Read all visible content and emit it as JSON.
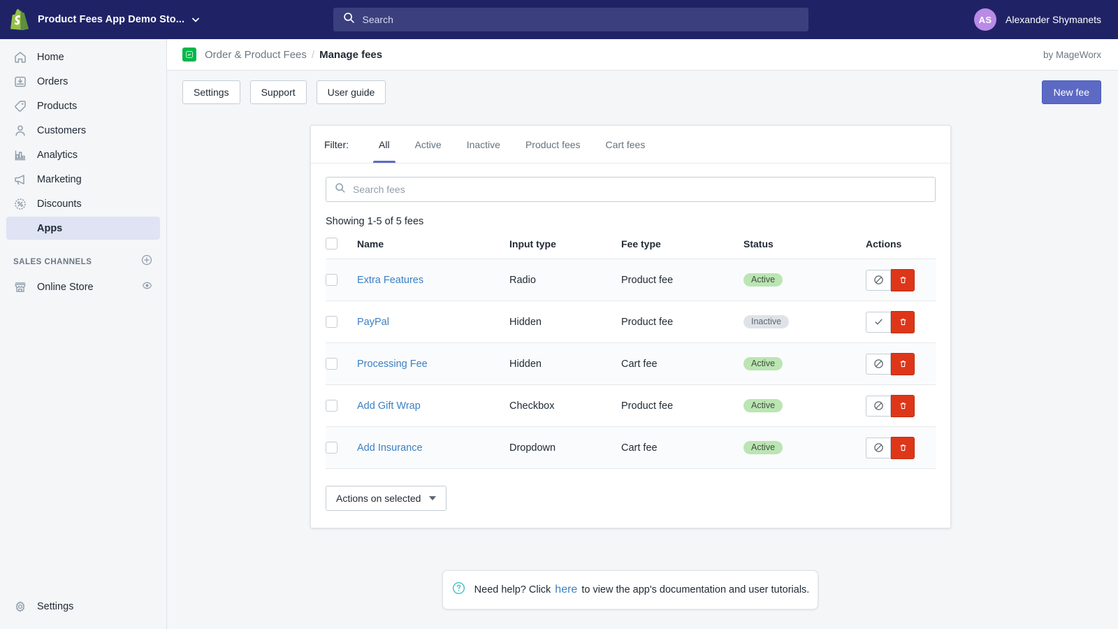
{
  "topbar": {
    "store_name": "Product Fees App Demo Sto...",
    "store_chevron_icon": "chevron-down-icon",
    "logo_icon": "shopify-logo-icon",
    "search_icon": "search-icon",
    "search_placeholder": "Search",
    "search_value": "",
    "user_initials": "AS",
    "user_name": "Alexander Shymanets",
    "avatar_color": "#b98ae6",
    "background_color": "#1f2366"
  },
  "sidebar": {
    "items": [
      {
        "label": "Home",
        "icon": "home-icon",
        "active": false
      },
      {
        "label": "Orders",
        "icon": "orders-icon",
        "active": false
      },
      {
        "label": "Products",
        "icon": "products-tag-icon",
        "active": false
      },
      {
        "label": "Customers",
        "icon": "customers-person-icon",
        "active": false
      },
      {
        "label": "Analytics",
        "icon": "analytics-bar-chart-icon",
        "active": false
      },
      {
        "label": "Marketing",
        "icon": "marketing-megaphone-icon",
        "active": false
      },
      {
        "label": "Discounts",
        "icon": "discounts-percent-icon",
        "active": false
      },
      {
        "label": "Apps",
        "icon": "apps-grid-plus-icon",
        "active": true
      }
    ],
    "section_title": "SALES CHANNELS",
    "section_add_icon": "plus-circle-icon",
    "channels": [
      {
        "label": "Online Store",
        "icon": "storefront-icon",
        "trailing_icon": "eye-icon"
      }
    ],
    "settings": {
      "label": "Settings",
      "icon": "gear-icon"
    },
    "active_color": "#3c459c4"
  },
  "breadcrumb": {
    "app_icon": "app-badge-icon",
    "app_icon_color": "#00b84a",
    "parent": "Order & Product Fees",
    "separator": "/",
    "current": "Manage fees",
    "byline": "by MageWorx"
  },
  "toolbar": {
    "settings_label": "Settings",
    "support_label": "Support",
    "user_guide_label": "User guide",
    "new_fee_label": "New fee",
    "primary_color": "#5c6ac4"
  },
  "filter": {
    "label": "Filter:",
    "tabs": [
      {
        "label": "All",
        "active": true
      },
      {
        "label": "Active",
        "active": false
      },
      {
        "label": "Inactive",
        "active": false
      },
      {
        "label": "Product fees",
        "active": false
      },
      {
        "label": "Cart fees",
        "active": false
      }
    ]
  },
  "search_fees": {
    "icon": "search-icon",
    "placeholder": "Search fees",
    "value": ""
  },
  "results": {
    "showing": "Showing 1-5 of 5 fees"
  },
  "table": {
    "columns": [
      "Name",
      "Input type",
      "Fee type",
      "Status",
      "Actions"
    ],
    "select_all_checked": false,
    "rows": [
      {
        "name": "Extra Features",
        "input_type": "Radio",
        "fee_type": "Product fee",
        "status": "Active",
        "checked": false,
        "toggle_icon": "disable-circle-slash-icon",
        "delete_icon": "trash-icon"
      },
      {
        "name": "PayPal",
        "input_type": "Hidden",
        "fee_type": "Product fee",
        "status": "Inactive",
        "checked": false,
        "toggle_icon": "enable-check-icon",
        "delete_icon": "trash-icon"
      },
      {
        "name": "Processing Fee",
        "input_type": "Hidden",
        "fee_type": "Cart fee",
        "status": "Active",
        "checked": false,
        "toggle_icon": "disable-circle-slash-icon",
        "delete_icon": "trash-icon"
      },
      {
        "name": "Add Gift Wrap",
        "input_type": "Checkbox",
        "fee_type": "Product fee",
        "status": "Active",
        "checked": false,
        "toggle_icon": "disable-circle-slash-icon",
        "delete_icon": "trash-icon"
      },
      {
        "name": "Add Insurance",
        "input_type": "Dropdown",
        "fee_type": "Cart fee",
        "status": "Active",
        "checked": false,
        "toggle_icon": "disable-circle-slash-icon",
        "delete_icon": "trash-icon"
      }
    ],
    "status_colors": {
      "active_bg": "#bbe5b3",
      "inactive_bg": "#dfe3e8",
      "delete_bg": "#de3618"
    }
  },
  "bulk_actions": {
    "label": "Actions on selected",
    "caret_icon": "caret-down-icon"
  },
  "help": {
    "icon": "question-circle-icon",
    "icon_color": "#47c1bf",
    "text_before": "Need help? Click",
    "link": "here",
    "text_after": "to view the app's documentation and user tutorials."
  }
}
